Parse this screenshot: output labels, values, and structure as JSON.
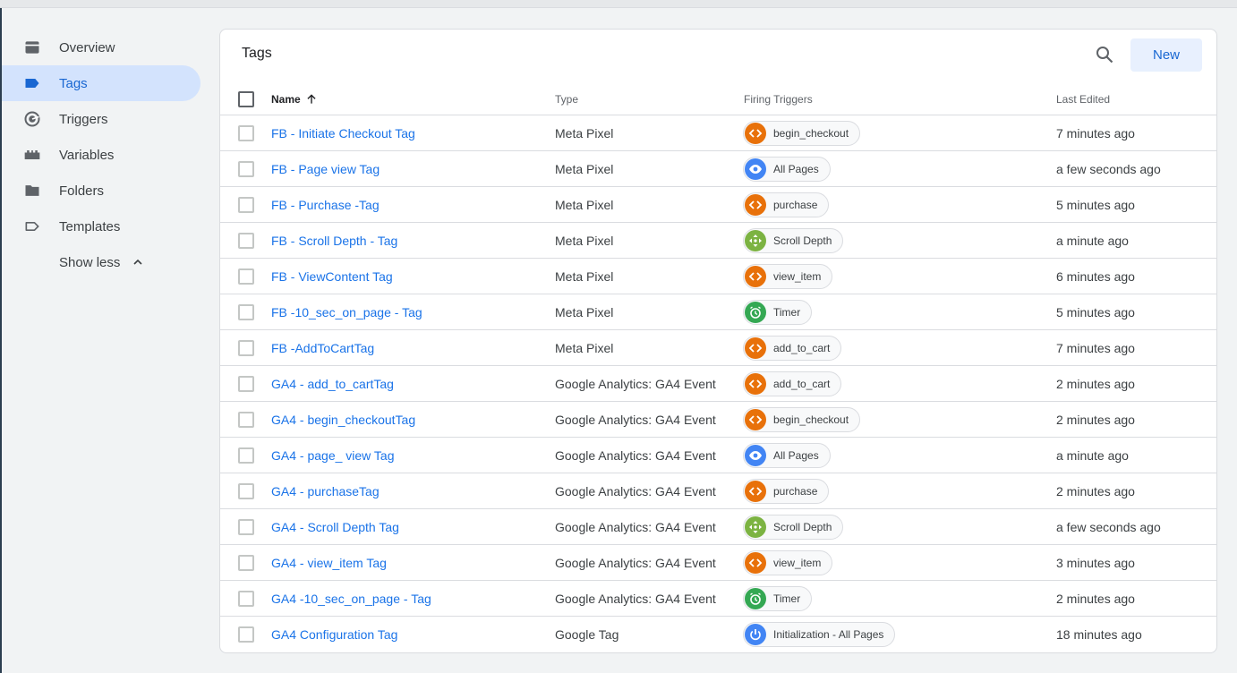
{
  "colors": {
    "accent": "#1a73e8",
    "active_nav_bg": "#d3e3fd",
    "custom_event": "#e8710a",
    "page_view": "#4285f4",
    "scroll": "#7cb342",
    "timer": "#34a853"
  },
  "sidebar": {
    "items": [
      {
        "label": "Overview",
        "icon": "overview-icon",
        "active": false
      },
      {
        "label": "Tags",
        "icon": "tag-icon",
        "active": true
      },
      {
        "label": "Triggers",
        "icon": "trigger-icon",
        "active": false
      },
      {
        "label": "Variables",
        "icon": "variables-icon",
        "active": false
      },
      {
        "label": "Folders",
        "icon": "folder-icon",
        "active": false
      },
      {
        "label": "Templates",
        "icon": "template-icon",
        "active": false
      }
    ],
    "show_less_label": "Show less"
  },
  "card": {
    "title": "Tags",
    "new_button_label": "New",
    "search_icon": "search-icon"
  },
  "table": {
    "headers": {
      "name": "Name",
      "type": "Type",
      "triggers": "Firing Triggers",
      "edited": "Last Edited"
    },
    "sort_icon": "arrow-up-icon",
    "rows": [
      {
        "name": "FB - Initiate Checkout Tag",
        "type": "Meta Pixel",
        "trigger": "begin_checkout",
        "trigger_kind": "custom",
        "edited": "7 minutes ago"
      },
      {
        "name": "FB - Page view Tag",
        "type": "Meta Pixel",
        "trigger": "All Pages",
        "trigger_kind": "page",
        "edited": "a few seconds ago"
      },
      {
        "name": "FB - Purchase -Tag",
        "type": "Meta Pixel",
        "trigger": "purchase",
        "trigger_kind": "custom",
        "edited": "5 minutes ago"
      },
      {
        "name": "FB - Scroll Depth - Tag",
        "type": "Meta Pixel",
        "trigger": "Scroll Depth",
        "trigger_kind": "scroll",
        "edited": "a minute ago"
      },
      {
        "name": "FB - ViewContent Tag",
        "type": "Meta Pixel",
        "trigger": "view_item",
        "trigger_kind": "custom",
        "edited": "6 minutes ago"
      },
      {
        "name": "FB -10_sec_on_page - Tag",
        "type": "Meta Pixel",
        "trigger": "Timer",
        "trigger_kind": "timer",
        "edited": "5 minutes ago"
      },
      {
        "name": "FB -AddToCartTag",
        "type": "Meta Pixel",
        "trigger": "add_to_cart",
        "trigger_kind": "custom",
        "edited": "7 minutes ago"
      },
      {
        "name": "GA4 - add_to_cartTag",
        "type": "Google Analytics: GA4 Event",
        "trigger": "add_to_cart",
        "trigger_kind": "custom",
        "edited": "2 minutes ago"
      },
      {
        "name": "GA4 - begin_checkoutTag",
        "type": "Google Analytics: GA4 Event",
        "trigger": "begin_checkout",
        "trigger_kind": "custom",
        "edited": "2 minutes ago"
      },
      {
        "name": "GA4 - page_ view Tag",
        "type": "Google Analytics: GA4 Event",
        "trigger": "All Pages",
        "trigger_kind": "page",
        "edited": "a minute ago"
      },
      {
        "name": "GA4 - purchaseTag",
        "type": "Google Analytics: GA4 Event",
        "trigger": "purchase",
        "trigger_kind": "custom",
        "edited": "2 minutes ago"
      },
      {
        "name": "GA4 - Scroll Depth Tag",
        "type": "Google Analytics: GA4 Event",
        "trigger": "Scroll Depth",
        "trigger_kind": "scroll",
        "edited": "a few seconds ago"
      },
      {
        "name": "GA4 - view_item Tag",
        "type": "Google Analytics: GA4 Event",
        "trigger": "view_item",
        "trigger_kind": "custom",
        "edited": "3 minutes ago"
      },
      {
        "name": "GA4 -10_sec_on_page - Tag",
        "type": "Google Analytics: GA4 Event",
        "trigger": "Timer",
        "trigger_kind": "timer",
        "edited": "2 minutes ago"
      },
      {
        "name": "GA4 Configuration Tag",
        "type": "Google Tag",
        "trigger": "Initialization - All Pages",
        "trigger_kind": "init",
        "edited": "18 minutes ago"
      }
    ]
  }
}
